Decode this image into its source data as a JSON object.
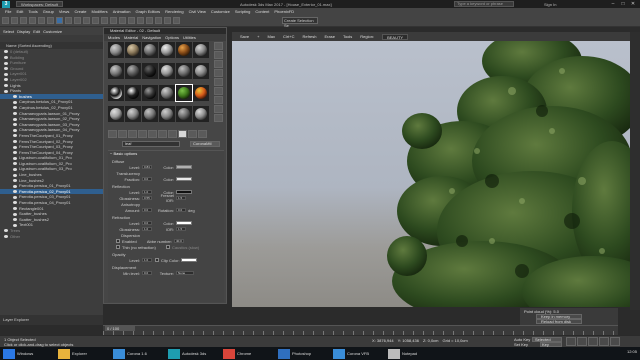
{
  "title_bar": {
    "app_icon": "3ds-max-logo",
    "workspace_label": "Workspaces: Default",
    "title": "Autodesk 3ds Max 2017 - [House_Exterior_01.max]",
    "search_placeholder": "Type a keyword or phrase",
    "sign_in": "Sign In",
    "minimize": "–",
    "maximize": "□",
    "close": "✕"
  },
  "menu_bar": {
    "items": [
      "File",
      "Edit",
      "Tools",
      "Group",
      "Views",
      "Create",
      "Modifiers",
      "Animation",
      "Graph Editors",
      "Rendering",
      "Civil View",
      "Customize",
      "Scripting",
      "Content",
      "PhoenixFD"
    ]
  },
  "main_toolbar": {
    "selection_set": "Create Selection Se"
  },
  "scene_explorer": {
    "tabs": [
      "Select",
      "Display",
      "Edit",
      "Customize"
    ],
    "header": "Name (Sorted Ascending)",
    "rows": [
      {
        "label": "0 (default)",
        "level": 0,
        "selected": false,
        "dim": true
      },
      {
        "label": "Building",
        "level": 0,
        "selected": false,
        "dim": true
      },
      {
        "label": "Furniture",
        "level": 0,
        "selected": false,
        "dim": true
      },
      {
        "label": "Ground",
        "level": 0,
        "selected": false,
        "dim": true
      },
      {
        "label": "Layer001",
        "level": 0,
        "selected": false,
        "dim": true
      },
      {
        "label": "Layer002",
        "level": 0,
        "selected": false,
        "dim": true
      },
      {
        "label": "Lights",
        "level": 0,
        "selected": false,
        "dim": false
      },
      {
        "label": "Plants",
        "level": 0,
        "selected": false,
        "dim": false
      },
      {
        "label": "bushes",
        "level": 1,
        "selected": true,
        "dim": false
      },
      {
        "label": "Carpinus.betulus_01_Proxy01",
        "level": 1,
        "selected": false,
        "dim": false
      },
      {
        "label": "Carpinus.betulus_02_Proxy01",
        "level": 1,
        "selected": false,
        "dim": false
      },
      {
        "label": "Chamaecyparis.lawson_01_Proxy",
        "level": 1,
        "selected": false,
        "dim": false
      },
      {
        "label": "Chamaecyparis.lawson_02_Proxy",
        "level": 1,
        "selected": false,
        "dim": false
      },
      {
        "label": "Chamaecyparis.lawson_03_Proxy",
        "level": 1,
        "selected": false,
        "dim": false
      },
      {
        "label": "Chamaecyparis.lawson_04_Proxy",
        "level": 1,
        "selected": false,
        "dim": false
      },
      {
        "label": "FernsTheCourtyard_01_Proxy",
        "level": 1,
        "selected": false,
        "dim": false
      },
      {
        "label": "FernsTheCourtyard_02_Proxy",
        "level": 1,
        "selected": false,
        "dim": false
      },
      {
        "label": "FernsTheCourtyard_03_Proxy",
        "level": 1,
        "selected": false,
        "dim": false
      },
      {
        "label": "FernsTheCourtyard_04_Proxy",
        "level": 1,
        "selected": false,
        "dim": false
      },
      {
        "label": "Ligustrum.ovalifolium_01_Pro",
        "level": 1,
        "selected": false,
        "dim": false
      },
      {
        "label": "Ligustrum.ovalifolium_02_Pro",
        "level": 1,
        "selected": false,
        "dim": false
      },
      {
        "label": "Ligustrum.ovalifolium_03_Pro",
        "level": 1,
        "selected": false,
        "dim": false
      },
      {
        "label": "Line_bushes",
        "level": 1,
        "selected": false,
        "dim": false
      },
      {
        "label": "Line_bushes2",
        "level": 1,
        "selected": false,
        "dim": false
      },
      {
        "label": "Parrotia.persica_01_Proxy01",
        "level": 1,
        "selected": false,
        "dim": false
      },
      {
        "label": "Parrotia.persica_02_Proxy01",
        "level": 1,
        "selected": true,
        "dim": false
      },
      {
        "label": "Parrotia.persica_03_Proxy01",
        "level": 1,
        "selected": false,
        "dim": false
      },
      {
        "label": "Parrotia.persica_04_Proxy01",
        "level": 1,
        "selected": false,
        "dim": false
      },
      {
        "label": "Rectangle001",
        "level": 1,
        "selected": false,
        "dim": false
      },
      {
        "label": "Scatter_bushes",
        "level": 1,
        "selected": false,
        "dim": false
      },
      {
        "label": "Scatter_bushes2",
        "level": 1,
        "selected": false,
        "dim": false
      },
      {
        "label": "Text001",
        "level": 1,
        "selected": false,
        "dim": false
      },
      {
        "label": "Trees",
        "level": 0,
        "selected": false,
        "dim": true
      },
      {
        "label": "Other",
        "level": 0,
        "selected": false,
        "dim": true
      }
    ],
    "footer": "Layer Explorer"
  },
  "material_editor": {
    "title": "Material Editor - 02 - Default",
    "menu": [
      "Modes",
      "Material",
      "Navigation",
      "Options",
      "Utilities"
    ],
    "spheres": [
      {
        "hi": "#cfcfcf",
        "mid": "#8a8a8a",
        "lo": "#333"
      },
      {
        "hi": "#d8c8a8",
        "mid": "#8c7a5c",
        "lo": "#2e271d"
      },
      {
        "hi": "#bfbfbf",
        "mid": "#6c6c6c",
        "lo": "#222"
      },
      {
        "hi": "#f0f0f0",
        "mid": "#9a9a9a",
        "lo": "#333"
      },
      {
        "hi": "#e7a14a",
        "mid": "#8a4d18",
        "lo": "#2a1706"
      },
      {
        "hi": "#d8d8d8",
        "mid": "#888",
        "lo": "#2a2a2a"
      },
      {
        "hi": "#c8c8c8",
        "mid": "#7a7a7a",
        "lo": "#2a2a2a"
      },
      {
        "hi": "#b0b0b0",
        "mid": "#5c5c5c",
        "lo": "#1e1e1e"
      },
      {
        "hi": "#666",
        "mid": "#222",
        "lo": "#000"
      },
      {
        "hi": "#e0e0e0",
        "mid": "#999",
        "lo": "#2e2e2e"
      },
      {
        "hi": "#bdbdbd",
        "mid": "#6e6e6e",
        "lo": "#222"
      },
      {
        "hi": "#cfcfcf",
        "mid": "#8a8a8a",
        "lo": "#333"
      },
      {
        "hi": "#ffffff",
        "mid": "#111111",
        "lo": "#ffffff"
      },
      {
        "hi": "#ffffff",
        "mid": "#222",
        "lo": "#000"
      },
      {
        "hi": "#9a9a9a",
        "mid": "#333",
        "lo": "#000"
      },
      {
        "hi": "#d0d0d0",
        "mid": "#7c7c7c",
        "lo": "#262626"
      },
      {
        "hi": "#7bc24a",
        "mid": "#3f7a1c",
        "lo": "#112006"
      },
      {
        "hi": "#e7c23a",
        "mid": "#d55a1a",
        "lo": "#3a1406"
      },
      {
        "hi": "#e0e0e0",
        "mid": "#a0a0a0",
        "lo": "#333"
      },
      {
        "hi": "#d0d0d0",
        "mid": "#888",
        "lo": "#2a2a2a"
      },
      {
        "hi": "#c4c4c4",
        "mid": "#7a7a7a",
        "lo": "#262626"
      },
      {
        "hi": "#cfcfcf",
        "mid": "#8a8a8a",
        "lo": "#303030"
      },
      {
        "hi": "#bababa",
        "mid": "#6a6a6a",
        "lo": "#202020"
      },
      {
        "hi": "#dcdcdc",
        "mid": "#8f8f8f",
        "lo": "#2a2a2a"
      }
    ],
    "material_name": "leaf",
    "material_type": "CoronaMtl",
    "rollout": {
      "title": "Basic options",
      "diffuse": {
        "section": "Diffuse",
        "level_label": "Level:",
        "level": "0.84",
        "color_label": "Color:",
        "color": "#b0b0b0",
        "translucency": "Translucency",
        "fraction_label": "Fraction:",
        "fraction": "0.0",
        "t_color": "#e8e8e8"
      },
      "reflection": {
        "section": "Reflection",
        "level_label": "Level:",
        "level": "1.0",
        "color_label": "Color:",
        "color": "#111111",
        "gloss_label": "Glossiness:",
        "gloss": "0.55",
        "fresnel_label": "Fresnel IOR:",
        "fresnel": "1.5",
        "aniso": "Anisotropy",
        "amount_label": "Amount:",
        "amount": "0.0",
        "rotation_label": "Rotation:",
        "rotation": "0.0",
        "deg": "deg"
      },
      "refraction": {
        "section": "Refraction",
        "level_label": "Level:",
        "level": "0.0",
        "color_label": "Color:",
        "color": "#ffffff",
        "gloss_label": "Glossiness:",
        "gloss": "1.0",
        "ior_label": "IOR:",
        "ior": "1.5",
        "dispersion": "Dispersion",
        "enabled": "Enabled",
        "abbe_label": "Abbe number:",
        "abbe": "40.0",
        "thin": "Thin (no refraction)",
        "caustics": "Caustics (slow)"
      },
      "opacity": {
        "section": "Opacity",
        "level_label": "Level:",
        "level": "1.0",
        "clip_label": "Clip",
        "color_label": "Color:",
        "color": "#ffffff"
      },
      "displacement": {
        "section": "Displacement",
        "min_label": "Min level:",
        "min": "0.0",
        "texture_label": "Texture:",
        "texture": "None"
      }
    }
  },
  "viewport": {
    "toolbar": [
      "Save",
      "+",
      "Max",
      "Clrt+C",
      "Refresh",
      "Erase",
      "Tools",
      "Region:",
      "BEAUTY"
    ]
  },
  "right_panel": {
    "label": "Point cloud (%):",
    "value": "5.0",
    "keep_btn": "Keep in memory",
    "reload_btn": "Reload from disk"
  },
  "time_slider": {
    "frame_label": "0 / 100"
  },
  "status_bar": {
    "line1": "1 Object Selected",
    "line2": "Click or click-and-drag to select objects",
    "coords": [
      "X: 3876,944",
      "Y: 1058,436",
      "Z: 0,0cm",
      "Grid = 10,0cm"
    ],
    "auto_key": "Auto Key",
    "auto_value": "Selected",
    "set_key": "Set Key",
    "key_filters": "Key Filters..."
  },
  "taskbar": {
    "items": [
      "Windows",
      "Explorer",
      "Corona 1.6",
      "Autodesk 3ds",
      "Chrome",
      "Photoshop",
      "Corona VFB",
      "Notepad"
    ],
    "time": "12:05"
  },
  "colors": {
    "ui_dark": "#2b2b2b",
    "ui_panel": "#444444",
    "selection_blue": "#2f5f8f",
    "sky": "#b9c0cc",
    "foliage": "#2d4a1f"
  }
}
